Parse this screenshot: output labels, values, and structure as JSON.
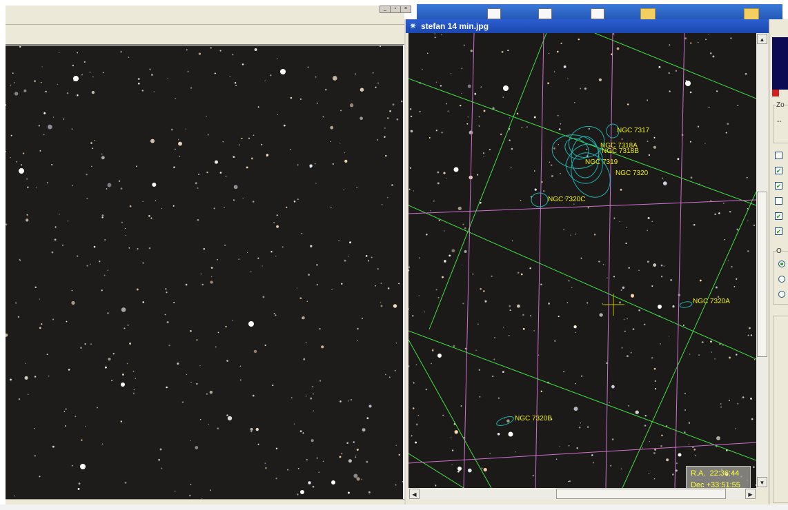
{
  "image_window": {
    "title": "stefan 14 min.jpg",
    "title_icon": "star-burst-icon"
  },
  "annotations": [
    {
      "label": "NGC 7317"
    },
    {
      "label": "NGC 7318A"
    },
    {
      "label": "NGC 7318B"
    },
    {
      "label": "NGC 7319"
    },
    {
      "label": "NGC 7320"
    },
    {
      "label": "NGC 7320C"
    },
    {
      "label": "NGC 7320A"
    },
    {
      "label": "NGC 7320B"
    }
  ],
  "coordinates": {
    "ra_text": "R.A.  22:36:44",
    "dec_text": "Dec +33:51:55"
  },
  "side_panel": {
    "zoom_label": "Zo",
    "zoom_value": "--",
    "options_label": "O",
    "checkboxes": [
      false,
      true,
      true,
      false,
      true,
      true
    ],
    "radio_selected": 0,
    "radio_count": 3
  },
  "colors": {
    "grid_green": "#40e040",
    "grid_magenta": "#d070d0",
    "label_yellow": "#f0f000",
    "galaxy_cyan": "#20b0b0",
    "title_bar_blue": "#1c47b0"
  }
}
